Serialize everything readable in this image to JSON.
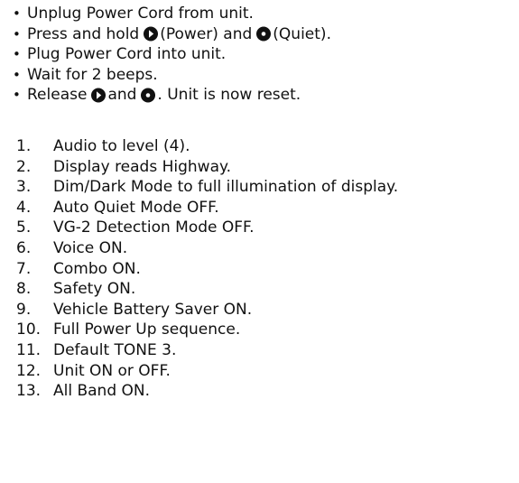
{
  "bullets": [
    {
      "before": "Unplug Power Cord from unit."
    },
    {
      "before": "Press and hold",
      "icon1": "power-button-icon",
      "middle": "(Power) and",
      "icon2": "quiet-button-icon",
      "after": "(Quiet)."
    },
    {
      "before": "Plug Power Cord into unit."
    },
    {
      "before": "Wait for 2 beeps."
    },
    {
      "before": "Release",
      "icon1": "power-button-icon",
      "middle": "and",
      "icon2": "quiet-button-icon",
      "after": ". Unit is now reset."
    }
  ],
  "defaults": [
    {
      "num": "1.",
      "text": "Audio to level (4)."
    },
    {
      "num": "2.",
      "text": "Display reads Highway."
    },
    {
      "num": "3.",
      "text": "Dim/Dark Mode to full illumination of display."
    },
    {
      "num": "4.",
      "text": "Auto Quiet Mode OFF."
    },
    {
      "num": "5.",
      "text": "VG-2 Detection Mode OFF."
    },
    {
      "num": "6.",
      "text": "Voice ON."
    },
    {
      "num": "7.",
      "text": "Combo ON."
    },
    {
      "num": "8.",
      "text": "Safety ON."
    },
    {
      "num": "9.",
      "text": "Vehicle Battery Saver ON."
    },
    {
      "num": "10.",
      "text": "Full Power Up sequence."
    },
    {
      "num": "11.",
      "text": "Default TONE 3."
    },
    {
      "num": "12.",
      "text": "Unit ON or OFF."
    },
    {
      "num": "13.",
      "text": "All Band ON."
    }
  ]
}
